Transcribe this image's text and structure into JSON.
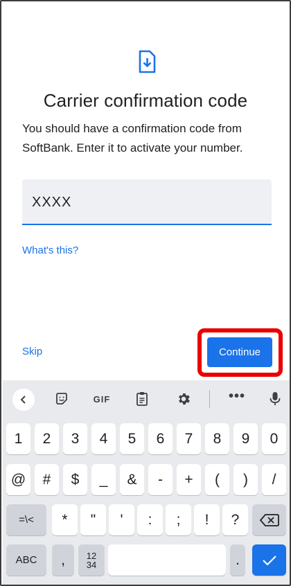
{
  "screen": {
    "title": "Carrier confirmation code",
    "subtitle": "You should have a confirmation code from SoftBank. Enter it to activate your number.",
    "code_field": {
      "value": "XXXX"
    },
    "whats_this_link": "What's this?",
    "skip_label": "Skip",
    "continue_label": "Continue"
  },
  "keyboard": {
    "toolbar": {
      "gif_label": "GIF",
      "more_label": "•••"
    },
    "row1": [
      "1",
      "2",
      "3",
      "4",
      "5",
      "6",
      "7",
      "8",
      "9",
      "0"
    ],
    "row2": [
      "@",
      "#",
      "$",
      "_",
      "&",
      "-",
      "+",
      "(",
      ")",
      "/"
    ],
    "row3": {
      "switch": "=\\<",
      "keys": [
        "*",
        "\"",
        "'",
        ":",
        ";",
        "!",
        "?"
      ]
    },
    "row4": {
      "abc": "ABC",
      "comma": ",",
      "numpad_top": "12",
      "numpad_bottom": "34",
      "period": "."
    }
  },
  "colors": {
    "accent": "#1a73e8",
    "highlight": "#ea0000",
    "keyboard_bg": "#e8eaed"
  }
}
